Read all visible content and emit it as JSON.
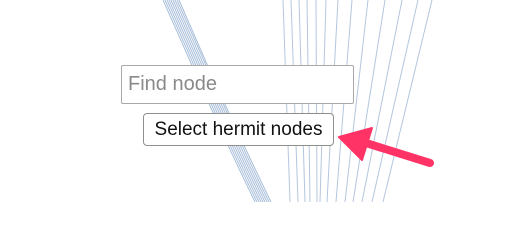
{
  "search": {
    "placeholder": "Find node",
    "value": ""
  },
  "actions": {
    "select_hermit_label": "Select hermit nodes"
  },
  "colors": {
    "edge": "#a9bfda",
    "edge_bundle": "#9fb8d6",
    "annotation_arrow": "#ff3366"
  },
  "annotation": {
    "icon": "arrow-pointer-icon"
  }
}
